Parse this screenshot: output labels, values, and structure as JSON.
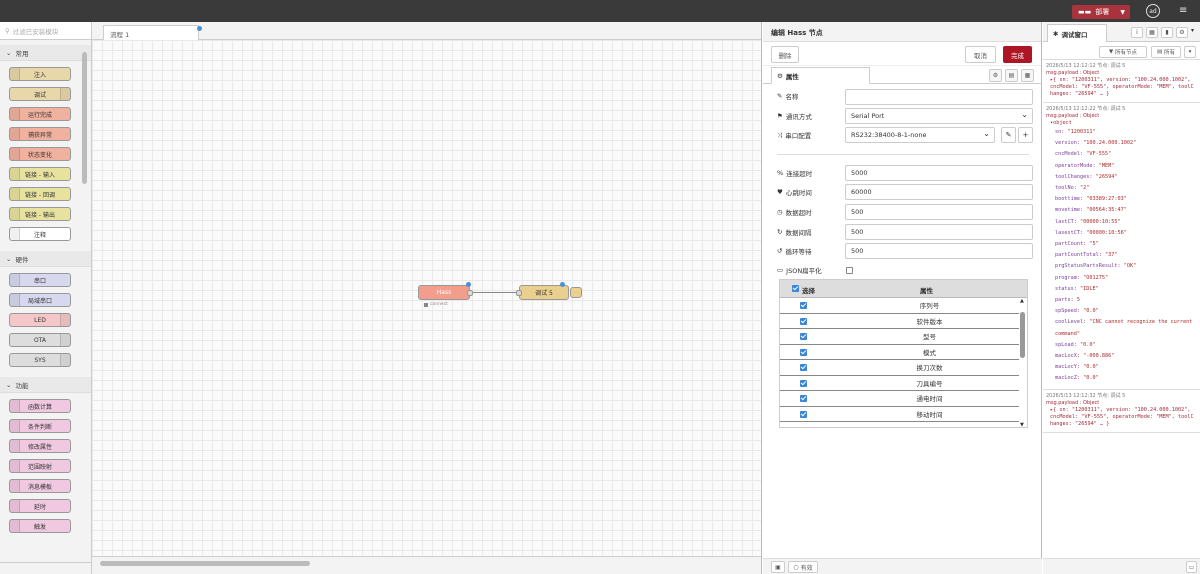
{
  "header": {
    "deploy_label": "部署",
    "user_initials": "ad"
  },
  "palette": {
    "search_placeholder": "过滤已安装模块",
    "categories": [
      {
        "name": "常用",
        "nodes": [
          {
            "label": "注入",
            "color": "#e7d7a9"
          },
          {
            "label": "调试",
            "color": "#e7d7a9"
          },
          {
            "label": "运行完成",
            "color": "#f0b19e"
          },
          {
            "label": "捕获异常",
            "color": "#f0b19e"
          },
          {
            "label": "状态变化",
            "color": "#f0b19e"
          },
          {
            "label": "链接 - 输入",
            "color": "#e7e29e"
          },
          {
            "label": "链接 - 回调",
            "color": "#e7e29e"
          },
          {
            "label": "链接 - 输出",
            "color": "#e7e29e"
          },
          {
            "label": "注释",
            "color": "#ffffff"
          }
        ]
      },
      {
        "name": "硬件",
        "nodes": [
          {
            "label": "串口",
            "color": "#d7d7f0"
          },
          {
            "label": "局域串口",
            "color": "#d7d7f0"
          },
          {
            "label": "LED",
            "color": "#f4c8c8"
          },
          {
            "label": "OTA",
            "color": "#dddddd"
          },
          {
            "label": "SYS",
            "color": "#dddddd"
          }
        ]
      },
      {
        "name": "功能",
        "nodes": [
          {
            "label": "函数计算",
            "color": "#f0c8e0"
          },
          {
            "label": "条件判断",
            "color": "#f0c8e0"
          },
          {
            "label": "修改属性",
            "color": "#f0c8e0"
          },
          {
            "label": "范围映射",
            "color": "#f0c8e0"
          },
          {
            "label": "消息模板",
            "color": "#f0c8e0"
          },
          {
            "label": "延时",
            "color": "#f0c8e0"
          },
          {
            "label": "触发",
            "color": "#f0c8e0"
          }
        ]
      }
    ]
  },
  "workspace": {
    "tab_label": "流程 1",
    "nodes": {
      "hass_label": "Hass",
      "hass_status": "connect",
      "debug_label": "调试 5"
    }
  },
  "editor": {
    "title": "编辑 Hass 节点",
    "delete_label": "删除",
    "cancel_label": "取消",
    "done_label": "完成",
    "props_tab": "属性",
    "fields": {
      "name_label": "名称",
      "name_value": "",
      "comm_label": "通讯方式",
      "comm_value": "Serial Port",
      "serial_label": "串口配置",
      "serial_value": "RS232:38400-8-1-none",
      "connect_timeout_label": "连接超时",
      "connect_timeout_value": "5000",
      "heartbeat_label": "心跳时间",
      "heartbeat_value": "60000",
      "data_timeout_label": "数据超时",
      "data_timeout_value": "500",
      "data_interval_label": "数据间隔",
      "data_interval_value": "500",
      "loop_wait_label": "循环等待",
      "loop_wait_value": "500",
      "json_flat_label": "JSON扁平化"
    },
    "table": {
      "col_select": "选择",
      "col_property": "属性",
      "rows": [
        "序列号",
        "软件版本",
        "型号",
        "模式",
        "换刀次数",
        "刀具编号",
        "通电时间",
        "移动时间"
      ]
    },
    "footer_enabled": "有效"
  },
  "debug": {
    "tab_label": "调试窗口",
    "filter_nodes": "所有节点",
    "filter_all": "所有",
    "messages": [
      {
        "meta": "2026/5/13 12:12:12   节点: 调试 5",
        "topic": "msg.payload : Object",
        "summary": "▸{ sn: \"1200311\", version: \"100.24.000.1002\", cncModel: \"VF-555\", operatorMode: \"MEM\", toolChanges: \"26594\" … }"
      },
      {
        "meta": "2026/5/13 12:12:22   节点: 调试 5",
        "topic": "msg.payload : Object",
        "expanded_label": "▾object",
        "props": [
          {
            "k": "sn",
            "v": "\"1200311\""
          },
          {
            "k": "version",
            "v": "\"100.24.000.1002\""
          },
          {
            "k": "cncModel",
            "v": "\"VF-555\""
          },
          {
            "k": "operatorMode",
            "v": "\"MEM\""
          },
          {
            "k": "toolChanges",
            "v": "\"26594\""
          },
          {
            "k": "toolNo",
            "v": "\"2\""
          },
          {
            "k": "boottime",
            "v": "\"03389:27:03\""
          },
          {
            "k": "movetime",
            "v": "\"00564:35:47\""
          },
          {
            "k": "lastCT",
            "v": "\"00000:10:55\""
          },
          {
            "k": "lasestCT",
            "v": "\"00000:10:56\""
          },
          {
            "k": "partCount",
            "v": "\"5\""
          },
          {
            "k": "partCountTotal",
            "v": "\"37\""
          },
          {
            "k": "prgStatusPartsResult",
            "v": "\"OK\""
          },
          {
            "k": "program",
            "v": "\"O01275\""
          },
          {
            "k": "status",
            "v": "\"IDLE\""
          },
          {
            "k": "parts",
            "v": "5"
          },
          {
            "k": "spSpeed",
            "v": "\"0.0\""
          },
          {
            "k": "coolLevel",
            "v": "\"CNC cannot recognize the current command\""
          },
          {
            "k": "spLoad",
            "v": "\"0.0\""
          },
          {
            "k": "macLocX",
            "v": "\"-000.886\""
          },
          {
            "k": "macLocY",
            "v": "\"0.0\""
          },
          {
            "k": "macLocZ",
            "v": "\"0.0\""
          }
        ]
      },
      {
        "meta": "2026/5/13 12:12:32   节点: 调试 5",
        "topic": "msg.payload : Object",
        "summary": "▸{ sn: \"1200311\", version: \"100.24.000.1002\", cncModel: \"VF-555\", operatorMode: \"MEM\", toolChanges: \"26594\" … }"
      }
    ]
  }
}
